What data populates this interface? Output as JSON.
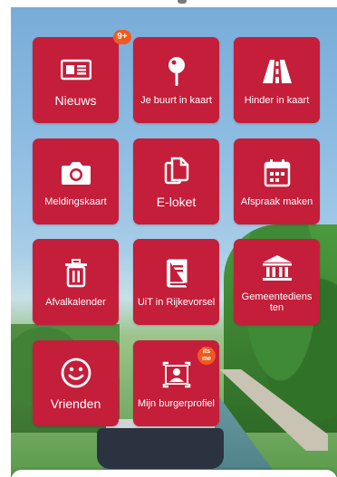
{
  "notification_badge": "9+",
  "itsme_badge": "its me",
  "colors": {
    "tile": "#c41e3a",
    "badge": "#f05a1e"
  },
  "tiles": [
    {
      "label": "Nieuws",
      "icon": "newspaper-icon"
    },
    {
      "label": "Je buurt in kaart",
      "icon": "map-pin-icon"
    },
    {
      "label": "Hinder in kaart",
      "icon": "road-icon"
    },
    {
      "label": "Meldingskaart",
      "icon": "camera-icon"
    },
    {
      "label": "E-loket",
      "icon": "documents-icon"
    },
    {
      "label": "Afspraak maken",
      "icon": "calendar-icon"
    },
    {
      "label": "Afvalkalender",
      "icon": "trash-icon"
    },
    {
      "label": "UiT in Rijkevorsel",
      "icon": "book-icon"
    },
    {
      "label": "Gemeentediens ten",
      "icon": "town-hall-icon"
    },
    {
      "label": "Vrienden",
      "icon": "smiley-icon"
    },
    {
      "label": "Mijn burgerprofiel",
      "icon": "profile-icon"
    }
  ]
}
